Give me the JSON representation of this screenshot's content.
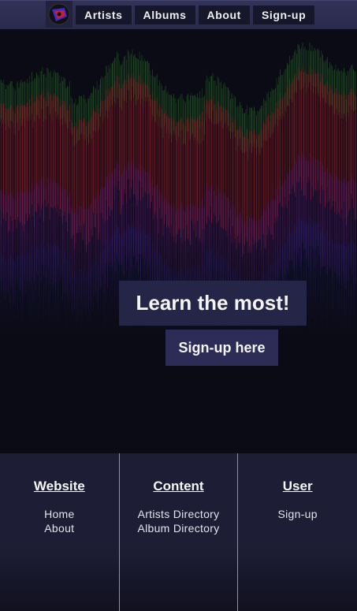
{
  "nav": {
    "logo_icon": "vinyl-record-logo-icon",
    "items": [
      {
        "label": "Artists"
      },
      {
        "label": "Albums"
      },
      {
        "label": "About"
      },
      {
        "label": "Sign-up"
      }
    ]
  },
  "hero": {
    "title": "Learn the most!",
    "button_label": "Sign-up here",
    "background": "audio-waveform-visualizer",
    "colors": {
      "green": "#2f8a2a",
      "red": "#b3202a",
      "purple": "#6a1e8c",
      "blue": "#2a2a9a",
      "bg": "#0b0b15"
    }
  },
  "footer": {
    "columns": [
      {
        "heading": "Website",
        "links": [
          "Home",
          "About"
        ]
      },
      {
        "heading": "Content",
        "links": [
          "Artists Directory",
          "Album Directory"
        ]
      },
      {
        "heading": "User",
        "links": [
          "Sign-up"
        ]
      }
    ]
  },
  "colors": {
    "nav_bg": "#2a2a4c",
    "nav_button_bg": "#17172c",
    "cta_title_bg": "#252547",
    "cta_button_bg": "#2c2c57",
    "footer_bg": "#1d1d35"
  }
}
